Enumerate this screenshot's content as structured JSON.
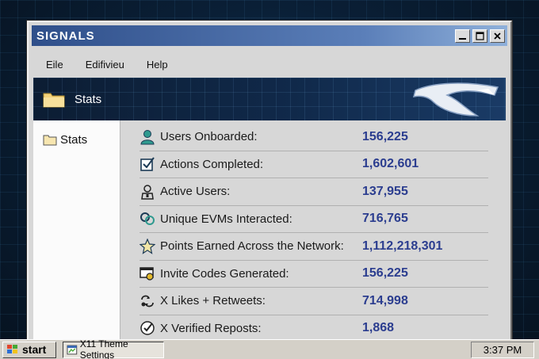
{
  "window": {
    "title": "SIGNALS",
    "controls": [
      "minimize-icon",
      "maximize-icon",
      "close-icon"
    ]
  },
  "menu": {
    "items": [
      "Eile",
      "Edifivieu",
      "Help"
    ]
  },
  "banner": {
    "title": "Stats",
    "icon": "folder-icon",
    "logo": "brand-logo"
  },
  "sidebar": {
    "items": [
      {
        "label": "Stats",
        "icon": "folder-icon"
      }
    ]
  },
  "stats": [
    {
      "label": "Users Onboarded:",
      "value": "156,225",
      "icon": "user-icon"
    },
    {
      "label": "Actions Completed:",
      "value": "1,602,601",
      "icon": "checkbox-icon"
    },
    {
      "label": "Active Users:",
      "value": "137,955",
      "icon": "person-icon"
    },
    {
      "label": "Unique EVMs Interacted:",
      "value": "716,765",
      "icon": "link-icon"
    },
    {
      "label": "Points Earned Across the Network:",
      "value": "1,112,218,301",
      "icon": "star-icon"
    },
    {
      "label": "Invite Codes Generated:",
      "value": "156,225",
      "icon": "ticket-icon"
    },
    {
      "label": "X Likes + Retweets:",
      "value": "714,998",
      "icon": "retweet-icon"
    },
    {
      "label": "X Verified Reposts:",
      "value": "1,868",
      "icon": "verified-check-icon"
    }
  ],
  "taskbar": {
    "start_label": "start",
    "task_label": "X11 Theme Settings",
    "clock": "3:37 PM"
  },
  "colors": {
    "value_text": "#2b3d8f",
    "titlebar": "#2f4f8a",
    "accent_teal": "#2f9a8f"
  }
}
